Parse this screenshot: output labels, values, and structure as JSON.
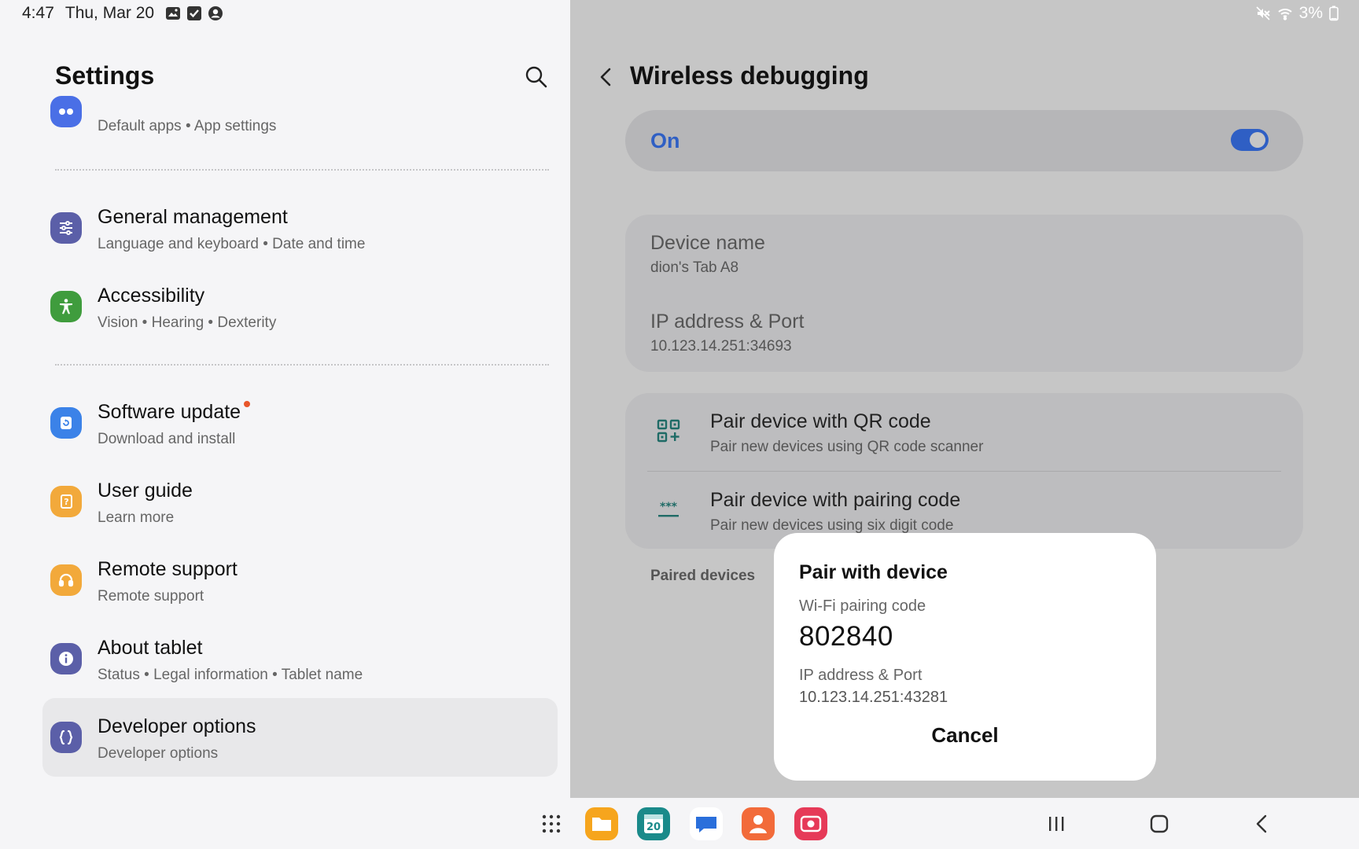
{
  "status": {
    "time": "4:47",
    "date": "Thu, Mar 20",
    "battery": "3%"
  },
  "left": {
    "title": "Settings",
    "items": [
      {
        "title": "",
        "sub": "Default apps  •  App settings"
      },
      {
        "title": "General management",
        "sub": "Language and keyboard  •  Date and time"
      },
      {
        "title": "Accessibility",
        "sub": "Vision  •  Hearing  •  Dexterity"
      },
      {
        "title": "Software update",
        "sub": "Download and install"
      },
      {
        "title": "User guide",
        "sub": "Learn more"
      },
      {
        "title": "Remote support",
        "sub": "Remote support"
      },
      {
        "title": "About tablet",
        "sub": "Status  •  Legal information  •  Tablet name"
      },
      {
        "title": "Developer options",
        "sub": "Developer options"
      }
    ]
  },
  "right": {
    "title": "Wireless debugging",
    "toggle_label": "On",
    "device_name_label": "Device name",
    "device_name_value": "dion's Tab A8",
    "ip_label": "IP address & Port",
    "ip_value": "10.123.14.251:34693",
    "pair_qr_title": "Pair device with QR code",
    "pair_qr_sub": "Pair new devices using QR code scanner",
    "pair_code_title": "Pair device with pairing code",
    "pair_code_sub": "Pair new devices using six digit code",
    "paired_devices_label": "Paired devices"
  },
  "dialog": {
    "title": "Pair with device",
    "code_label": "Wi-Fi pairing code",
    "code": "802840",
    "ip_label": "IP address & Port",
    "ip_value": "10.123.14.251:43281",
    "cancel": "Cancel"
  },
  "colors": {
    "accent": "#2f5fc4",
    "software_update_dot": "#e8562a"
  },
  "icons": [
    "search-icon",
    "back-icon",
    "qr-code-icon",
    "pairing-code-icon",
    "mute-icon",
    "wifi-icon",
    "battery-icon"
  ]
}
